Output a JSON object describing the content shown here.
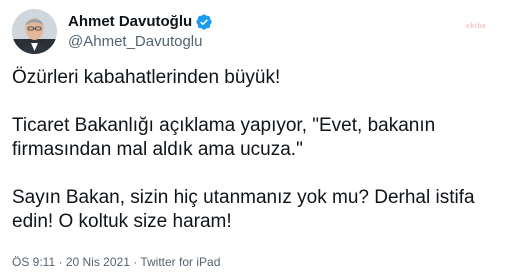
{
  "author": {
    "display_name": "Ahmet Davutoğlu",
    "handle": "@Ahmet_Davutoglu",
    "verified_icon": "verified-badge-icon",
    "avatar_icon": "profile-photo"
  },
  "watermark": "ekibe",
  "tweet": {
    "paragraphs": [
      "Özürleri kabahatlerinden büyük!",
      "Ticaret Bakanlığı açıklama yapıyor, \"Evet, bakanın firmasından mal aldık ama ucuza.\"",
      "Sayın Bakan, sizin hiç utanmanız yok mu? Derhal istifa edin! O koltuk size haram!"
    ]
  },
  "meta": {
    "time": "ÖS 9:11",
    "separator": "·",
    "date": "20 Nis 2021",
    "source": "Twitter for iPad"
  },
  "colors": {
    "verified_blue": "#1d9bf0",
    "text_primary": "#0f1419",
    "text_secondary": "#536471"
  }
}
